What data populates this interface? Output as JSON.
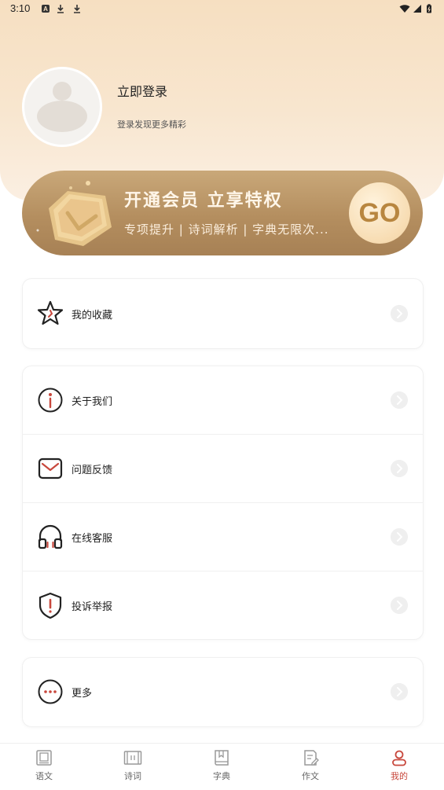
{
  "status": {
    "time": "3:10"
  },
  "profile": {
    "title": "立即登录",
    "subtitle": "登录发现更多精彩"
  },
  "vip": {
    "title": "开通会员  立享特权",
    "subtitle": "专项提升 | 诗词解析 | 字典无限次...",
    "go": "GO"
  },
  "menu": {
    "favorites": "我的收藏",
    "about": "关于我们",
    "feedback": "问题反馈",
    "service": "在线客服",
    "complaint": "投诉举报",
    "more": "更多"
  },
  "nav": {
    "items": [
      {
        "label": "语文",
        "icon": "book-icon"
      },
      {
        "label": "诗词",
        "icon": "scroll-icon"
      },
      {
        "label": "字典",
        "icon": "dictionary-icon"
      },
      {
        "label": "作文",
        "icon": "essay-icon"
      },
      {
        "label": "我的",
        "icon": "profile-icon"
      }
    ],
    "active_color": "#c8483d"
  },
  "colors": {
    "accent": "#c8483d",
    "gold": "#b48e5f"
  }
}
